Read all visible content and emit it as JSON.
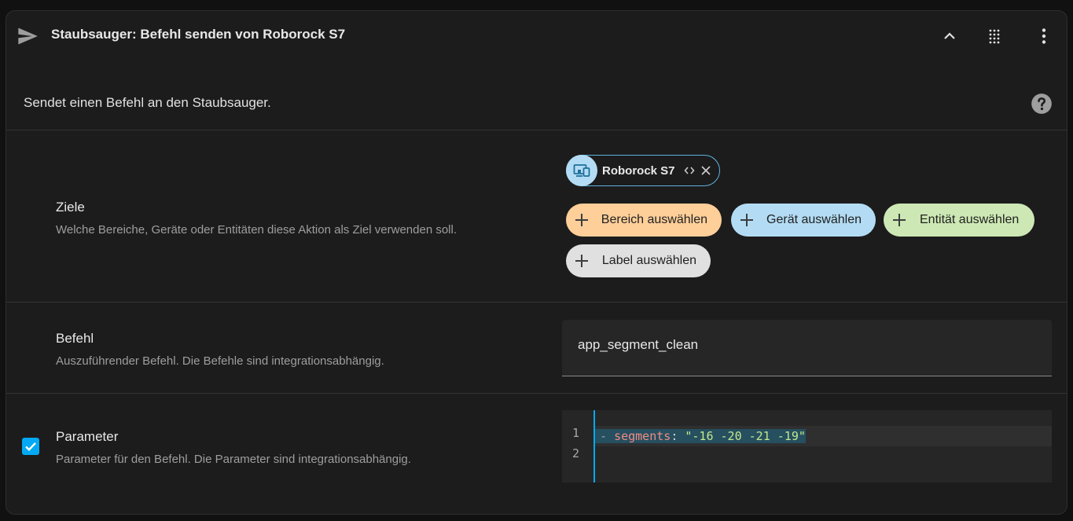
{
  "header": {
    "title": "Staubsauger: Befehl senden von Roborock S7"
  },
  "description": "Sendet einen Befehl an den Staubsauger.",
  "fields": {
    "ziele": {
      "label": "Ziele",
      "sub": "Welche Bereiche, Geräte oder Entitäten diese Aktion als Ziel verwenden soll."
    },
    "befehl": {
      "label": "Befehl",
      "sub": "Auszuführender Befehl. Die Befehle sind integrationsabhängig.",
      "value": "app_segment_clean"
    },
    "parameter": {
      "label": "Parameter",
      "sub": "Parameter für den Befehl. Die Parameter sind integrationsabhängig.",
      "checked": true
    }
  },
  "target_chip": {
    "name": "Roborock S7",
    "avatar_color": "#b3dcf4"
  },
  "add_chips": [
    {
      "label": "Bereich auswählen",
      "color": "#ffcf99"
    },
    {
      "label": "Gerät auswählen",
      "color": "#b3dcf4"
    },
    {
      "label": "Entität auswählen",
      "color": "#cde8b4"
    },
    {
      "label": "Label auswählen",
      "color": "#e0e0e0"
    }
  ],
  "code": {
    "line_numbers": [
      "1",
      "2"
    ],
    "dash": "- ",
    "key": "segments",
    "colon": ": ",
    "value": "\"-16 -20 -21 -19\""
  },
  "accent_color": "#03a9f4"
}
